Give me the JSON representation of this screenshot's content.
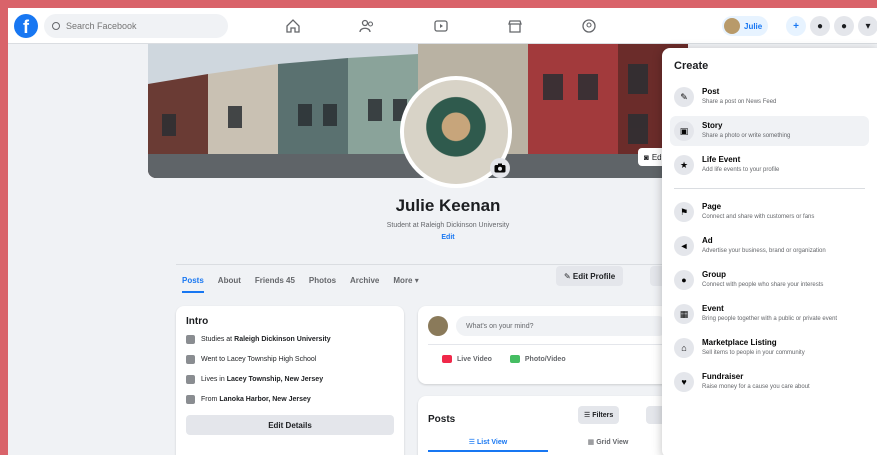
{
  "colors": {
    "brand": "#1877f2",
    "page_bg": "#f0f2f5",
    "outer_frame": "#d9636a"
  },
  "topbar": {
    "search_placeholder": "Search Facebook",
    "account_name": "Julie",
    "nav_icons": [
      "home-icon",
      "friends-icon",
      "watch-icon",
      "marketplace-icon",
      "groups-icon"
    ]
  },
  "profile": {
    "name": "Julie Keenan",
    "bio": "Student at Raleigh Dickinson University",
    "bio_edit": "Edit",
    "cover_edit_label": "Edit",
    "tabs": [
      "Posts",
      "About",
      "Friends 45",
      "Photos",
      "Archive",
      "More ▾"
    ],
    "edit_profile_label": "✎ Edit Profile"
  },
  "intro": {
    "title": "Intro",
    "rows": [
      {
        "prefix": "Studies at",
        "value": "Raleigh Dickinson University"
      },
      {
        "prefix": "Went to Lacey Township High School",
        "value": ""
      },
      {
        "prefix": "Lives in",
        "value": "Lacey Township, New Jersey"
      },
      {
        "prefix": "From",
        "value": "Lanoka Harbor, New Jersey"
      }
    ],
    "edit_details_label": "Edit Details"
  },
  "composer": {
    "placeholder": "What's on your mind?",
    "actions": [
      {
        "label": "Live Video",
        "color": "#f02849"
      },
      {
        "label": "Photo/Video",
        "color": "#45bd62"
      }
    ]
  },
  "posts": {
    "title": "Posts",
    "filters_label": "☰ Filters",
    "views": [
      "☰ List View",
      "▦ Grid View"
    ]
  },
  "create_menu": {
    "title": "Create",
    "items": [
      {
        "icon": "post-icon",
        "glyph": "✎",
        "title": "Post",
        "desc": "Share a post on News Feed",
        "highlight": false
      },
      {
        "icon": "story-icon",
        "glyph": "▣",
        "title": "Story",
        "desc": "Share a photo or write something",
        "highlight": true
      },
      {
        "icon": "life-event-icon",
        "glyph": "★",
        "title": "Life Event",
        "desc": "Add life events to your profile",
        "highlight": false
      },
      {
        "sep": true
      },
      {
        "icon": "page-icon",
        "glyph": "⚑",
        "title": "Page",
        "desc": "Connect and share with customers or fans",
        "highlight": false
      },
      {
        "icon": "ad-icon",
        "glyph": "◄",
        "title": "Ad",
        "desc": "Advertise your business, brand or organization",
        "highlight": false
      },
      {
        "icon": "group-icon",
        "glyph": "●",
        "title": "Group",
        "desc": "Connect with people who share your interests",
        "highlight": false
      },
      {
        "icon": "event-icon",
        "glyph": "▦",
        "title": "Event",
        "desc": "Bring people together with a public or private event",
        "highlight": false
      },
      {
        "icon": "marketplace-listing-icon",
        "glyph": "⌂",
        "title": "Marketplace Listing",
        "desc": "Sell items to people in your community",
        "highlight": false
      },
      {
        "icon": "fundraiser-icon",
        "glyph": "♥",
        "title": "Fundraiser",
        "desc": "Raise money for a cause you care about",
        "highlight": false
      }
    ]
  }
}
